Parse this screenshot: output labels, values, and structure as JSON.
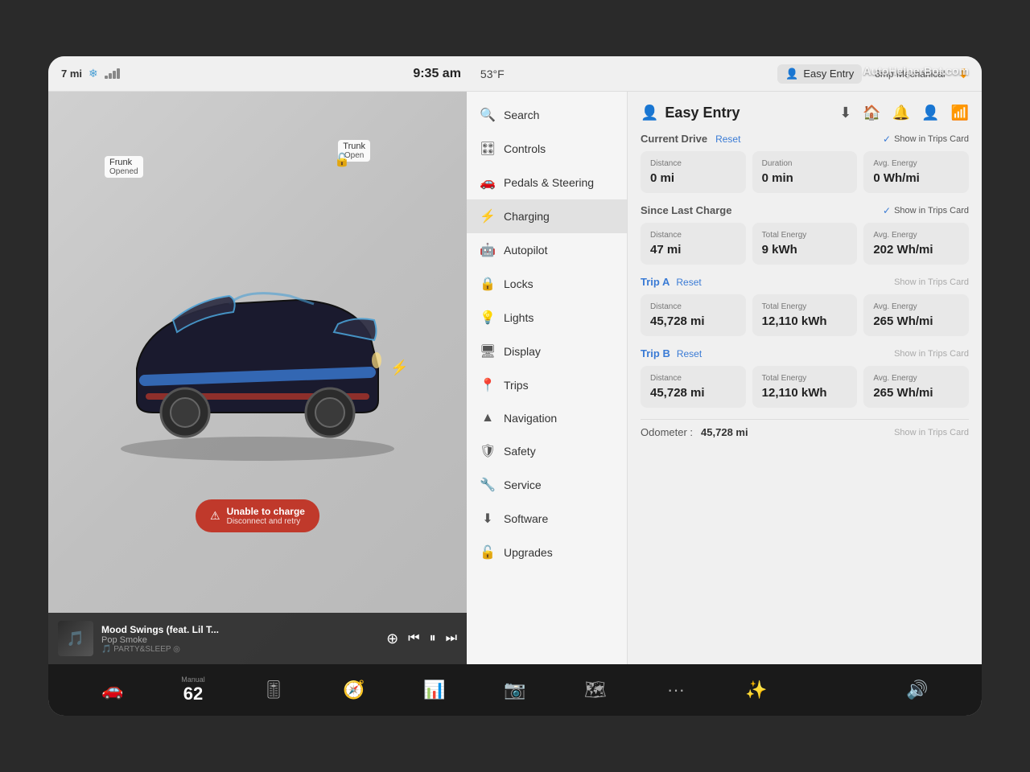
{
  "watermark": "AutoHelperBot.com",
  "topBar": {
    "range": "7 mi",
    "time": "9:35 am",
    "temp": "53°F",
    "easyEntry": "Easy Entry",
    "service": "8mp Mechanical"
  },
  "carLabels": {
    "frunk": "Frunk\nOpened",
    "trunk": "Trunk\nOpen"
  },
  "chargeAlert": {
    "title": "Unable to charge",
    "subtitle": "Disconnect and retry"
  },
  "music": {
    "title": "Mood Swings (feat. Lil T...",
    "artist": "Pop Smoke",
    "playlist": "PARTY&SLEEP"
  },
  "menu": {
    "items": [
      {
        "icon": "🔍",
        "label": "Search"
      },
      {
        "icon": "🎛",
        "label": "Controls"
      },
      {
        "icon": "🚗",
        "label": "Pedals & Steering"
      },
      {
        "icon": "⚡",
        "label": "Charging"
      },
      {
        "icon": "🤖",
        "label": "Autopilot"
      },
      {
        "icon": "🔒",
        "label": "Locks"
      },
      {
        "icon": "💡",
        "label": "Lights"
      },
      {
        "icon": "🖥",
        "label": "Display"
      },
      {
        "icon": "📍",
        "label": "Trips"
      },
      {
        "icon": "▲",
        "label": "Navigation"
      },
      {
        "icon": "🛡",
        "label": "Safety"
      },
      {
        "icon": "🔧",
        "label": "Service"
      },
      {
        "icon": "⬇",
        "label": "Software"
      },
      {
        "icon": "🔓",
        "label": "Upgrades"
      }
    ]
  },
  "rightPanel": {
    "title": "Easy Entry",
    "sections": {
      "currentDrive": {
        "title": "Current Drive",
        "showTrips": "Show in Trips Card",
        "stats": [
          {
            "label": "Distance",
            "value": "0 mi"
          },
          {
            "label": "Duration",
            "value": "0 min"
          },
          {
            "label": "Avg. Energy",
            "value": "0 Wh/mi"
          }
        ]
      },
      "sinceLastCharge": {
        "title": "Since Last Charge",
        "showTrips": "Show in Trips Card",
        "stats": [
          {
            "label": "Distance",
            "value": "47 mi"
          },
          {
            "label": "Total Energy",
            "value": "9 kWh"
          },
          {
            "label": "Avg. Energy",
            "value": "202 Wh/mi"
          }
        ]
      },
      "tripA": {
        "title": "Trip A",
        "showTrips": "Show in Trips Card",
        "stats": [
          {
            "label": "Distance",
            "value": "45,728 mi"
          },
          {
            "label": "Total Energy",
            "value": "12,110 kWh"
          },
          {
            "label": "Avg. Energy",
            "value": "265 Wh/mi"
          }
        ]
      },
      "tripB": {
        "title": "Trip B",
        "showTrips": "Show in Trips Card",
        "stats": [
          {
            "label": "Distance",
            "value": "45,728 mi"
          },
          {
            "label": "Total Energy",
            "value": "12,110 kWh"
          },
          {
            "label": "Avg. Energy",
            "value": "265 Wh/mi"
          }
        ]
      }
    },
    "odometer": {
      "label": "Odometer :",
      "value": "45,728 mi"
    }
  },
  "taskbar": {
    "speedLabel": "Manual",
    "speedValue": "62",
    "icons": [
      "🚗",
      "🚦",
      "🧭",
      "📊",
      "📷",
      "🗺",
      "···",
      "✨",
      "",
      "🔊"
    ]
  }
}
